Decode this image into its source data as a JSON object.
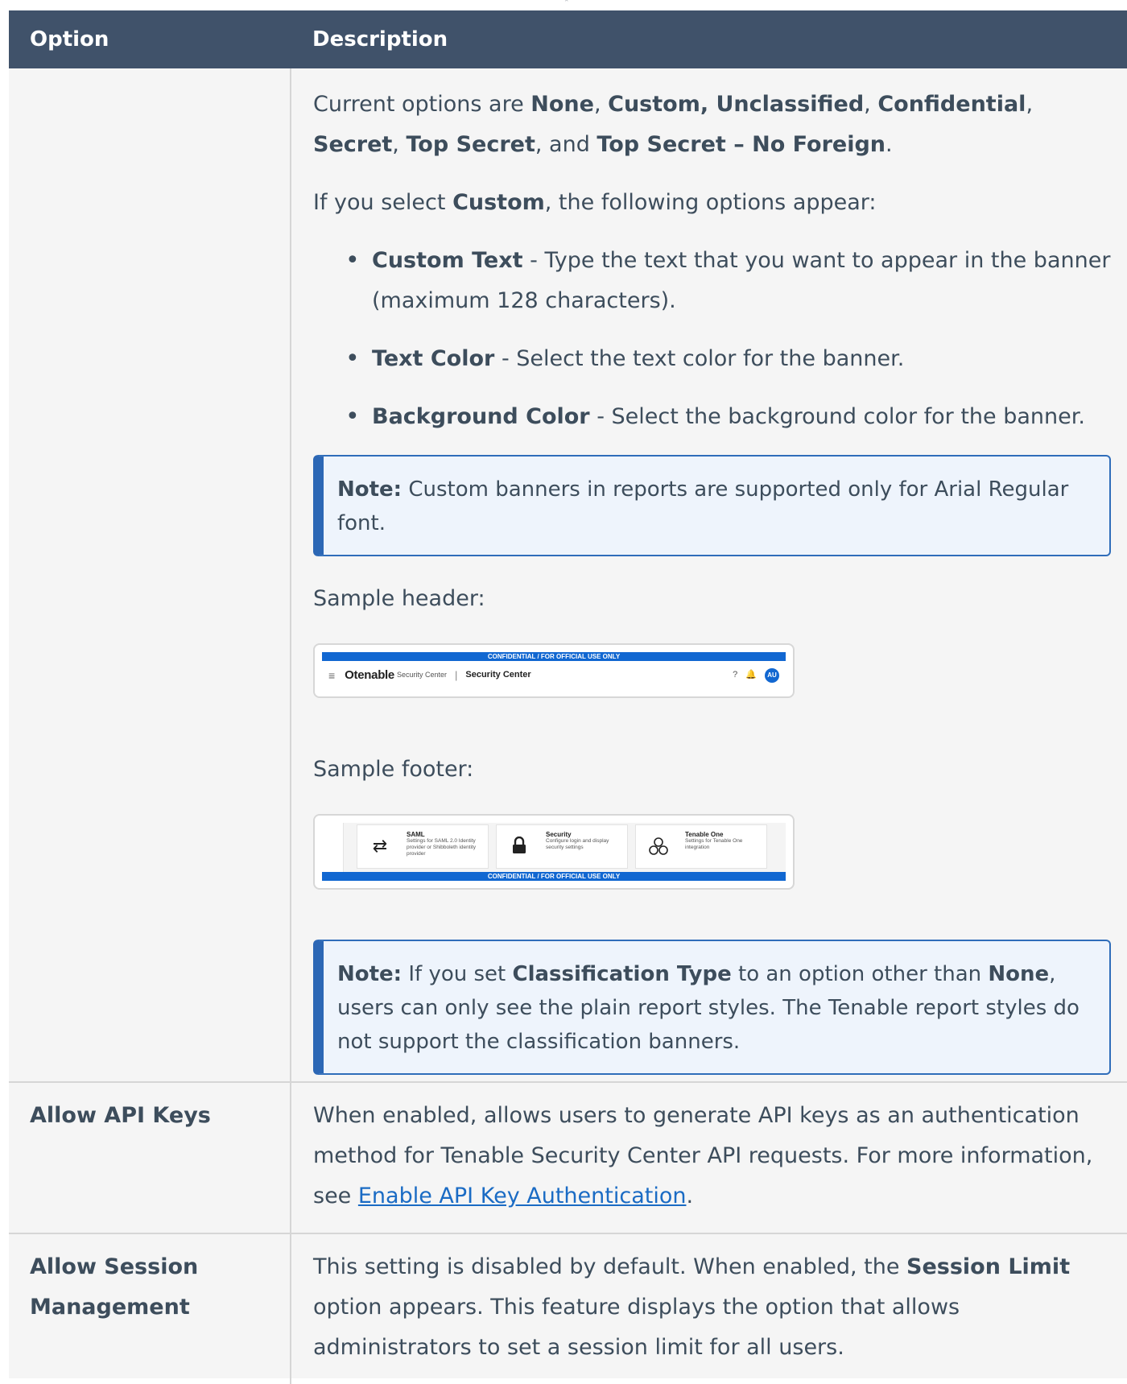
{
  "table": {
    "headers": {
      "option": "Option",
      "description": "Description"
    },
    "classification": {
      "intro_prefix": "Current options are ",
      "opt_none": "None",
      "sep1": ", ",
      "opt_custom_unclassified": "Custom, Unclassified",
      "sep2": ", ",
      "opt_confidential": "Confidential",
      "sep3": ", ",
      "opt_secret": "Secret",
      "sep4": ", ",
      "opt_top_secret": "Top Secret",
      "sep5": ", and ",
      "opt_top_secret_nf": "Top Secret – No Foreign",
      "end": ".",
      "custom_prefix": "If you select ",
      "custom_word": "Custom",
      "custom_suffix": ", the following options appear:",
      "bullets": [
        {
          "term": "Custom Text",
          "text": " - Type the text that you want to appear in the banner (maximum 128 characters)."
        },
        {
          "term": "Text Color",
          "text": " - Select the text color for the banner."
        },
        {
          "term": "Background Color",
          "text": " - Select the background color for the banner."
        }
      ],
      "note1_label": "Note:",
      "note1_text": " Custom banners in reports are supported only for Arial Regular font.",
      "sample_header_label": "Sample header:",
      "sample_footer_label": "Sample footer:",
      "note2_label": "Note:",
      "note2_a": " If you set ",
      "note2_b": "Classification Type",
      "note2_c": " to an option other than ",
      "note2_d": "None",
      "note2_e": ", users can only see the plain report styles. The Tenable report styles do not support the classification banners."
    },
    "api_keys": {
      "option": "Allow API Keys",
      "text": "When enabled, allows users to generate API keys as an authentication method for Tenable Security Center API requests. For more information, see ",
      "link": "Enable API Key Authentication",
      "end": "."
    },
    "session": {
      "option": "Allow Session Management",
      "a": "This setting is disabled by default. When enabled, the ",
      "b": "Session Limit",
      "c": " option appears. This feature displays the option that allows administrators to set a session limit for all users."
    }
  },
  "sample_header": {
    "banner": "CONFIDENTIAL / FOR OFFICIAL USE ONLY",
    "logo": "tenable",
    "logo_sub": "Security Center",
    "separator": "|",
    "product": "Security Center",
    "avatar": "AU"
  },
  "sample_footer": {
    "banner": "CONFIDENTIAL / FOR OFFICIAL USE ONLY",
    "cards": [
      {
        "title": "SAML",
        "desc": "Settings for SAML 2.0 Identity provider or Shibboleth identity provider",
        "icon": "transfer-arrows-icon"
      },
      {
        "title": "Security",
        "desc": "Configure login and display security settings",
        "icon": "lock-icon"
      },
      {
        "title": "Tenable One",
        "desc": "Settings for Tenable One integration",
        "icon": "hexagons-icon"
      }
    ]
  },
  "colors": {
    "header_bg": "#40526a",
    "note_border": "#2c67b5",
    "link": "#1a6bc4",
    "banner": "#1167d1"
  }
}
